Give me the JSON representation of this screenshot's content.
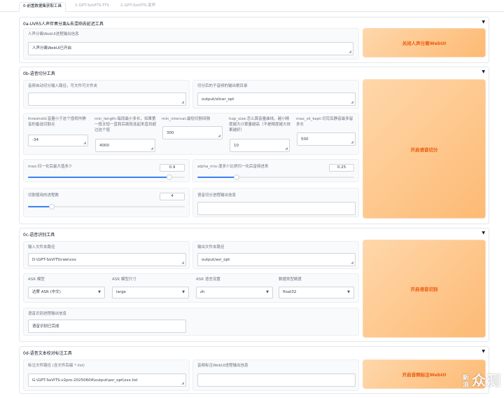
{
  "tabs": [
    "0-前置数据集获取工具",
    "1-GPT-SoVITS-TTS",
    "2-GPT-SoVITS-变声"
  ],
  "uvr": {
    "title": "0a-UVR5人声伴奏分离&去混响去延迟工具",
    "info_label": "人声分离WebUI进程输出信息",
    "info_value": "人声分离WebUI已开启",
    "button": "关闭人声分离WebUI"
  },
  "slicer": {
    "title": "0b-语音切分工具",
    "input_label": "音频自动切分输入路径，可文件可文件夹",
    "input_value": "",
    "output_label": "切分后的子音频的输出根目录",
    "output_value": "output/slicer_opt",
    "params": [
      {
        "label": "threshold:音量小于这个值视作静音的备选切割点",
        "value": "-34"
      },
      {
        "label": "min_length:每段最小多长，如果第一段太短一直和后面段连起来直到超过这个值",
        "value": "4000"
      },
      {
        "label": "min_interval:最短切割间隔",
        "value": "300"
      },
      {
        "label": "hop_size:怎么算音量曲线，越小精度越大计算量越高（不是精度越大效果越好）",
        "value": "10"
      },
      {
        "label": "max_sil_kept:切完后静音最多留多长",
        "value": "500"
      }
    ],
    "max_label": "max:归一化后最大值多少",
    "max_value": "0.9",
    "max_fraction": 0.9,
    "alpha_label": "alpha_mix:混多少比例归一化后音频进来",
    "alpha_value": "0.25",
    "alpha_fraction": 0.25,
    "procs_label": "切割使用的进程数",
    "procs_value": "4",
    "procs_fraction": 0.15,
    "info_label": "语音切分进程输出信息",
    "info_value": "",
    "button": "开启语音切分"
  },
  "asr": {
    "title": "0c-语音识别工具",
    "input_label": "输入文件夹路径",
    "input_value": "D:\\GPT-SoVITS\\raw\\xxx",
    "output_label": "输出文件夹路径",
    "output_value": "output/asr_opt",
    "model_label": "ASR 模型",
    "model_value": "达摩 ASR (中文)",
    "size_label": "ASR 模型尺寸",
    "size_value": "large",
    "lang_label": "ASR 语言设置",
    "lang_value": "zh",
    "precision_label": "数据类型精度",
    "precision_value": "float32",
    "info_label": "语音识别进程输出信息",
    "info_value": "语音识别已完成",
    "button": "开启语音识别"
  },
  "label": {
    "title": "0d-语音文本校对标注工具",
    "path_label": "标注文件路径 (含文件后缀 *.list)",
    "path_value": "G:\\GPT-SoVITS-v2pro-20250604\\output\\asr_opt\\xxx.list",
    "info_label": "音频标注WebUI进程输出信息",
    "info_value": "",
    "button": "开启音频标注WebUI"
  },
  "watermark": {
    "cell_top": "新",
    "cell_bottom": "浪",
    "text": "众测"
  },
  "colors": {
    "accent": "#ea580c",
    "button_gradient_start": "#fed7aa",
    "button_gradient_end": "#fdba74",
    "slider": "#3b82f6"
  }
}
